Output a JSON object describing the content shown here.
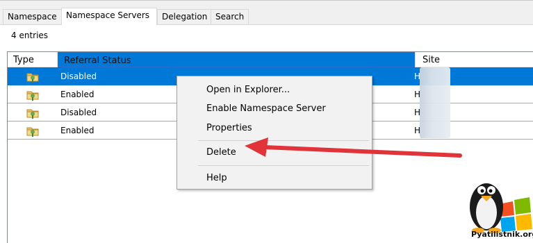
{
  "tabs": [
    "Namespace",
    "Namespace Servers",
    "Delegation",
    "Search"
  ],
  "active_tab": "Namespace Servers",
  "entries_count": "4 entries",
  "columns": {
    "type": "Type",
    "status": "Referral Status",
    "site": "Site"
  },
  "rows": [
    {
      "status": "Disabled",
      "site": "H",
      "selected": true,
      "icon": "folder-share-icon"
    },
    {
      "status": "Enabled",
      "site": "H",
      "selected": false,
      "icon": "folder-share-icon"
    },
    {
      "status": "Disabled",
      "site": "H",
      "selected": false,
      "icon": "folder-share-icon"
    },
    {
      "status": "Enabled",
      "site": "H",
      "selected": false,
      "icon": "folder-share-icon"
    }
  ],
  "context_menu": {
    "items": [
      "Open in Explorer...",
      "Enable Namespace Server",
      "Properties",
      "Delete",
      "Help"
    ]
  },
  "watermark": "Pyatilistnik.org",
  "colors": {
    "selection": "#0078d7",
    "arrow": "#e0333a",
    "menu_bg": "#f2f2f2"
  }
}
